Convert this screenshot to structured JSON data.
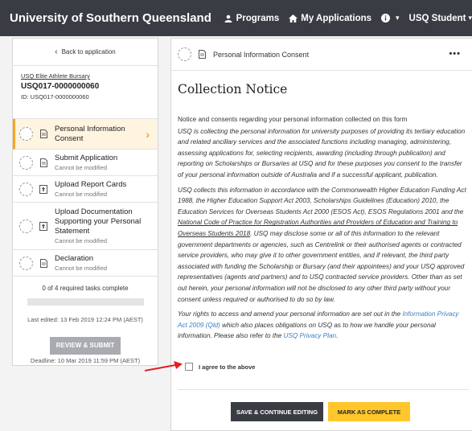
{
  "brand": "University of Southern Queensland",
  "nav": {
    "programs": "Programs",
    "applications": "My Applications",
    "info_caret": "▾",
    "user": "USQ Student",
    "user_caret": "▾"
  },
  "left": {
    "back": "Back to application",
    "app_link": "USQ Elite Athlete Bursary",
    "app_code": "USQ017-0000000060",
    "app_id": "ID: USQ017-0000000060",
    "tasks": [
      {
        "title": "Personal Information Consent",
        "sub": ""
      },
      {
        "title": "Submit Application",
        "sub": "Cannot be modified"
      },
      {
        "title": "Upload Report Cards",
        "sub": "Cannot be modified"
      },
      {
        "title": "Upload Documentation Supporting your Personal Statement",
        "sub": "Cannot be modified"
      },
      {
        "title": "Declaration",
        "sub": "Cannot be modified"
      }
    ],
    "progress_text": "0 of 4 required tasks complete",
    "progress_fraction": 0,
    "last_edited": "Last edited: 13 Feb 2019 12:24 PM (AEST)",
    "review_btn": "REVIEW & SUBMIT",
    "deadline": "Deadline: 10 Mar 2019 11:59 PM (AEST)"
  },
  "right": {
    "header_title": "Personal Information Consent",
    "menu": "•••",
    "heading": "Collection Notice",
    "intro": "Notice and consents regarding your personal information collected on this form",
    "p1": "USQ is collecting the personal information for university purposes of providing its tertiary education and related ancillary services and the associated functions including managing, administering, assessing applications for, selecting recipients, awarding (including through publication) and reporting on Scholarships or Bursaries at USQ and for these purposes you consent to the transfer of your personal information outside of Australia and if a successful applicant, publication.",
    "p2a": "USQ collects this information in accordance with the Commonwealth Higher Education Funding Act 1988, the Higher Education Support Act 2003, Scholarships Guidelines (Education) 2010, the Education Services for Overseas Students Act 2000 (ESOS Act), ESOS Regulations 2001 and the ",
    "p2u": "National Code of Practice for Registration Authorities and Providers of Education and Training to Overseas Students 2018",
    "p2b": ". USQ may disclose some or all of this information to the relevant government departments or agencies, such as Centrelink or their authorised agents or contracted service providers, who may give it to other government entities, and if relevant, the third party associated with funding the Scholarship or Bursary (and their appointees) and your USQ approved representatives (agents and partners) and to USQ contracted service providers. Other than as set out herein, your personal information will not be disclosed to any other third party without your consent unless required or authorised to do so by law.",
    "p3a": "Your rights to access and amend your personal information are set out in the ",
    "p3link1": "Information Privacy Act 2009 (Qld)",
    "p3b": " which also places obligations on USQ as to how we handle your personal information. Please also refer to the ",
    "p3link2": "USQ Privacy Plan",
    "p3c": ".",
    "agree": "I agree to the above",
    "save_btn": "SAVE & CONTINUE EDITING",
    "complete_btn": "MARK AS COMPLETE"
  },
  "colors": {
    "topbar": "#3a3c44",
    "accent": "#f5a623",
    "complete": "#ffc72c",
    "link": "#3b7fc4",
    "arrow": "#e02020"
  }
}
